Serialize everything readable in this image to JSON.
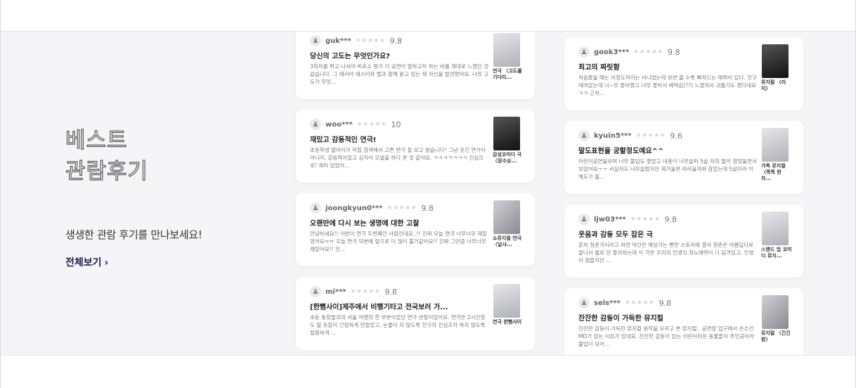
{
  "section": {
    "title_line1": "베스트",
    "title_line2": "관람후기",
    "subtitle": "생생한 관람 후기를 만나보세요!",
    "view_all": "전체보기",
    "chevron": "›"
  },
  "reviews_left": [
    {
      "user": "guk***",
      "stars": "★★★★★",
      "score": "9.8",
      "title": "당신의 고도는 무엇인가요?",
      "body": "3회차를 뛰고 나서야 비로소 뭔가 이 공연이 말하고자 하는 바를 제대로 느꼈던 것 같습니다. 그 때서야 에스터와 벨과 함께 묻고 있는 제 자신을 발견했어요. 나의 고도가 무엇...",
      "poster_title": "연극 〈고도를 기다리..."
    },
    {
      "user": "woo***",
      "stars": "★★★★★",
      "score": "10",
      "title": "재밌고 감동적인 연극!",
      "body": "초등학생 딸아이가 직접 검색해서 고른 연극 잘 보고 왔습니다! 그냥 웃긴 연극이 아니라, 감동적이었고 심지어 오열을 하다 온 것 같아요. ㅋㅋㅋㅋㅋㅋㅋ 진심으로! 재미 있었어...",
      "poster_title": "감성코미디 극 〈장수상..."
    },
    {
      "user": "joongkyun0***",
      "stars": "★★★★★",
      "score": "9.8",
      "title": "오랜만에 다시 보는 생명에 대한 고찰",
      "body": "안녕하세요!! 이번이 연극 두번째인 사람인데요..!! 진짜 오늘 연극 너무너무 재밌었어요ㅠㅠ 오늘 연극 덕분에 앞으로 더 많이 볼거같아요!! 진짜 그만큼 너무너무 재밌어요!! 진...",
      "poster_title": "쇼뮤지컬 연극 〈날사..."
    },
    {
      "user": "mi***",
      "stars": "★★★★★",
      "score": "9.8",
      "title": "[한뼘사이]제주에서 비행기타고 전국보러 가...",
      "body": "초등 동창들과의 서울 여행의 한 부분이었던 연극 관람이었어요. 연극은 2시간정도 될 듯합이 긴장하게 만들었고, 눈물이 지 않도록 친구의 진심조차 하지 않도록 집중하게 ...",
      "poster_title": "연극 한뼘사이"
    }
  ],
  "reviews_right": [
    {
      "user": "gook3***",
      "stars": "★★★★★",
      "score": "9.8",
      "title": "최고의 짜릿함",
      "body": "처음봤을 때는 이정도까지는 아니었는데 보면 볼 수록 빠져드는 매력이 있다. 친구 데려갔는데 너~무 좋아했고 너무 좋아서 배역감(??) 느꼈져서 괴롭기도 했다네요 ㅋㅋ 근처...",
      "poster_title": "뮤지컬 〈리지〉"
    },
    {
      "user": "kyuin5***",
      "stars": "★★★★★",
      "score": "9.6",
      "title": "말도표현을 궁할정도예요^^",
      "body": "어린이공연을보며 너무 몰입도 좋았고 내용이 너무슬퍼 5살 저희 딸이 엉엉울면서 보았어요ㅜㅜ 사실저도 너무슬펐지만 제가울면 따라울까봐 참았는데 5살이라 이해도가 될...",
      "poster_title": "가족 뮤지컬 〈똑똑 한 차..."
    },
    {
      "user": "ljw03***",
      "stars": "★★★★★",
      "score": "9.8",
      "title": "웃음과 감동 모두 잡은 극",
      "body": "흔히 청춘극이라고 하면 약간은 예상가는 뻔한 스토리에 결국 청춘은 아름답다로 끝나서 별로 안 좋아하는데 이 극은 우리의 인생의 희노애락이 다 담겨있고, 인생이 힘들지만 ...",
      "poster_title": "스탠드 업 코미디 뮤지..."
    },
    {
      "user": "sels***",
      "stars": "★★★★★",
      "score": "9.8",
      "title": "잔잔한 감동이 가득한 뮤지컬",
      "body": "잔잔한 감동이 가득한 뮤지컬 원작을 모르고 본 뮤지컬.. 공연장 입구에서 손수건 MD가 있는 이유가 있네요. 잔잔한 감동이 있는 어린이타운 동물들이 주인공이라 몰입이 되어...",
      "poster_title": "뮤지컬 〈긴긴밤〉"
    }
  ]
}
